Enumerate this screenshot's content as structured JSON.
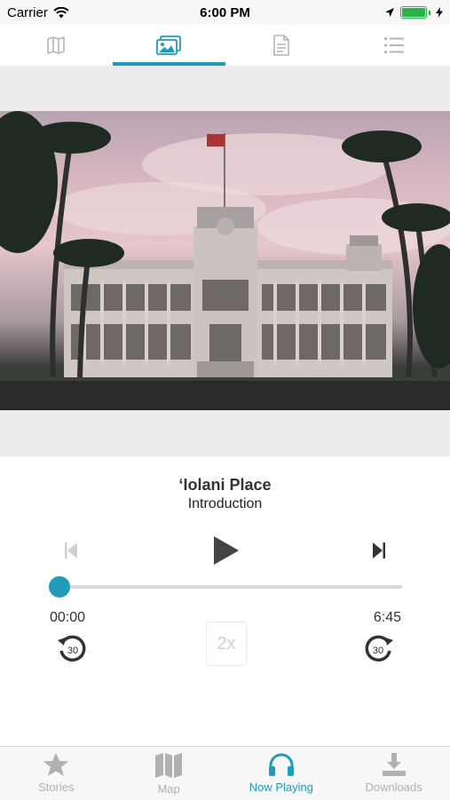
{
  "status": {
    "carrier": "Carrier",
    "time": "6:00 PM"
  },
  "top_tabs": [
    {
      "icon": "map-icon",
      "active": false
    },
    {
      "icon": "images-icon",
      "active": true
    },
    {
      "icon": "document-icon",
      "active": false
    },
    {
      "icon": "list-icon",
      "active": false
    }
  ],
  "player": {
    "title": "ʻIolani Place",
    "subtitle": "Introduction",
    "elapsed": "00:00",
    "duration": "6:45",
    "progress": 0,
    "speed_label": "2x",
    "rewind_label": "30",
    "forward_label": "30"
  },
  "bottom_tabs": [
    {
      "label": "Stories",
      "icon": "star-icon",
      "active": false
    },
    {
      "label": "Map",
      "icon": "map-icon",
      "active": false
    },
    {
      "label": "Now Playing",
      "icon": "headphones-icon",
      "active": true
    },
    {
      "label": "Downloads",
      "icon": "download-icon",
      "active": false
    }
  ],
  "colors": {
    "accent": "#1f9cb8",
    "inactive": "#b0b0b0"
  }
}
